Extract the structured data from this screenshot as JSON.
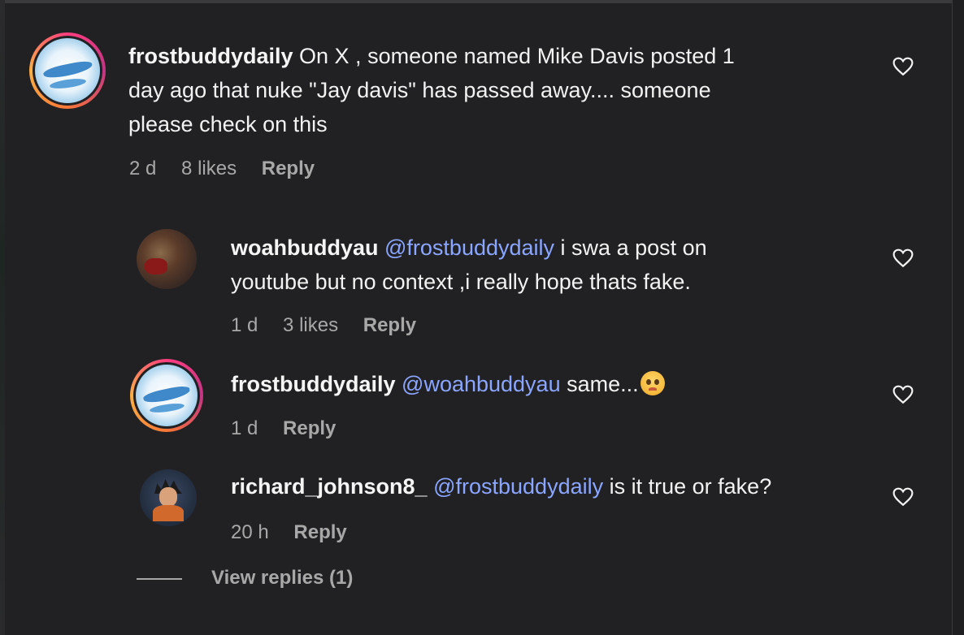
{
  "comments": [
    {
      "username": "frostbuddydaily",
      "mention": "",
      "body_line1": "On X , someone named Mike Davis posted 1",
      "body_line2": "day ago that nuke \"Jay davis\" has passed away.... someone",
      "body_line3": "please check on this",
      "time": "2 d",
      "likes": "8 likes",
      "reply": "Reply"
    },
    {
      "username": "woahbuddyau",
      "mention": "@frostbuddydaily",
      "body_line1": "i swa a post on",
      "body_line2": "youtube but no context ,i really hope thats fake.",
      "time": "1 d",
      "likes": "3 likes",
      "reply": "Reply"
    },
    {
      "username": "frostbuddydaily",
      "mention": "@woahbuddyau",
      "body_line1": "same...",
      "emoji": "crying-face-emoji",
      "time": "1 d",
      "reply": "Reply"
    },
    {
      "username": "richard_johnson8_",
      "mention": "@frostbuddydaily",
      "body_line1": "is it true or fake?",
      "time": "20 h",
      "reply": "Reply"
    }
  ],
  "view_replies": "View replies (1)",
  "icons": {
    "like": "heart-icon"
  },
  "colors": {
    "background": "#212124",
    "mention": "#8aa6ff",
    "meta": "#a8a8a8"
  }
}
